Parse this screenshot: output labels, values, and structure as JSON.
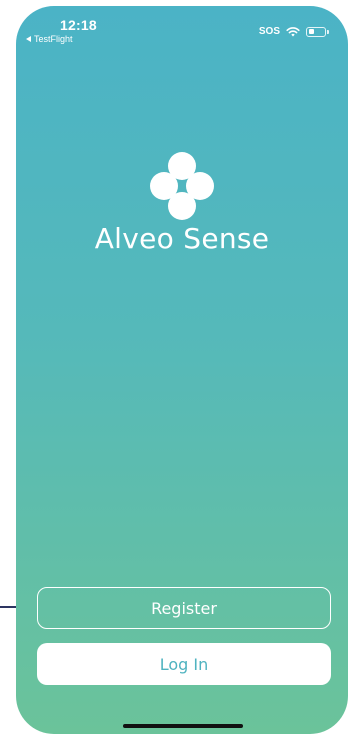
{
  "status_bar": {
    "time": "12:18",
    "back_app": "TestFlight",
    "sos": "SOS",
    "icons": [
      "wifi-icon",
      "battery-icon"
    ]
  },
  "app": {
    "title": "Alveo Sense",
    "logo_icon": "four-circles-logo"
  },
  "buttons": {
    "register_label": "Register",
    "login_label": "Log In"
  },
  "colors": {
    "gradient_top": "#4bb3c6",
    "gradient_bottom": "#6bc39a",
    "login_text": "#4fb3c0"
  }
}
